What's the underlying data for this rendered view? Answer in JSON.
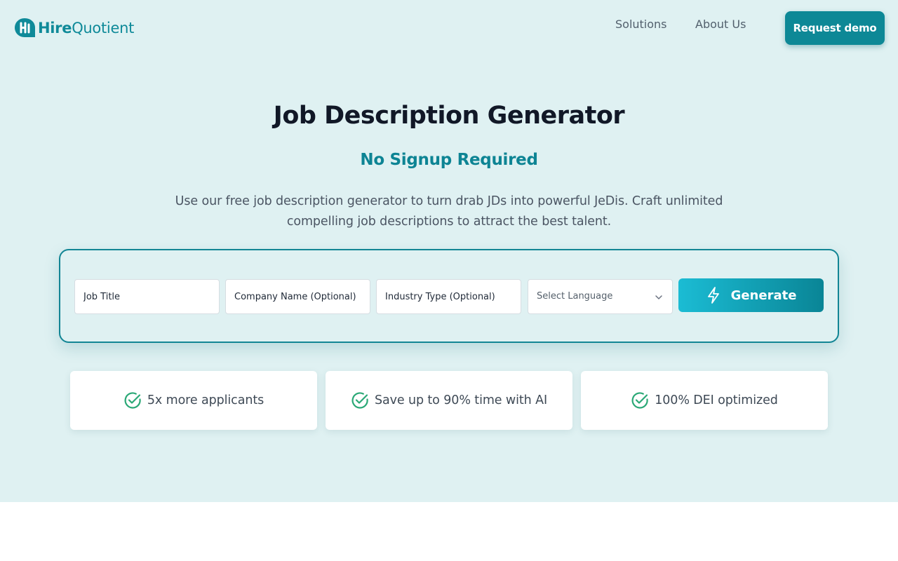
{
  "header": {
    "logo_hire": "Hire",
    "logo_quotient": "Quotient",
    "nav": [
      "Solutions",
      "About Us"
    ],
    "cta_label": "Request demo"
  },
  "hero": {
    "title": "Job Description Generator",
    "subtitle": "No Signup Required",
    "description": "Use our free job description generator to turn drab JDs into powerful JeDis. Craft unlimited compelling job descriptions to attract the best talent."
  },
  "form": {
    "job_title_placeholder": "Job Title",
    "company_placeholder": "Company Name (Optional)",
    "industry_placeholder": "Industry Type (Optional)",
    "language_selected": "Select Language",
    "generate_label": "Generate"
  },
  "features": [
    {
      "label": "5x more applicants",
      "icon": "check-circle-icon"
    },
    {
      "label": "Save up to 90% time with AI",
      "icon": "check-circle-icon"
    },
    {
      "label": "100% DEI optimized",
      "icon": "check-circle-icon"
    }
  ],
  "colors": {
    "brand": "#0d8896",
    "hero_bg": "#dff1f2",
    "check": "#2aa876"
  }
}
